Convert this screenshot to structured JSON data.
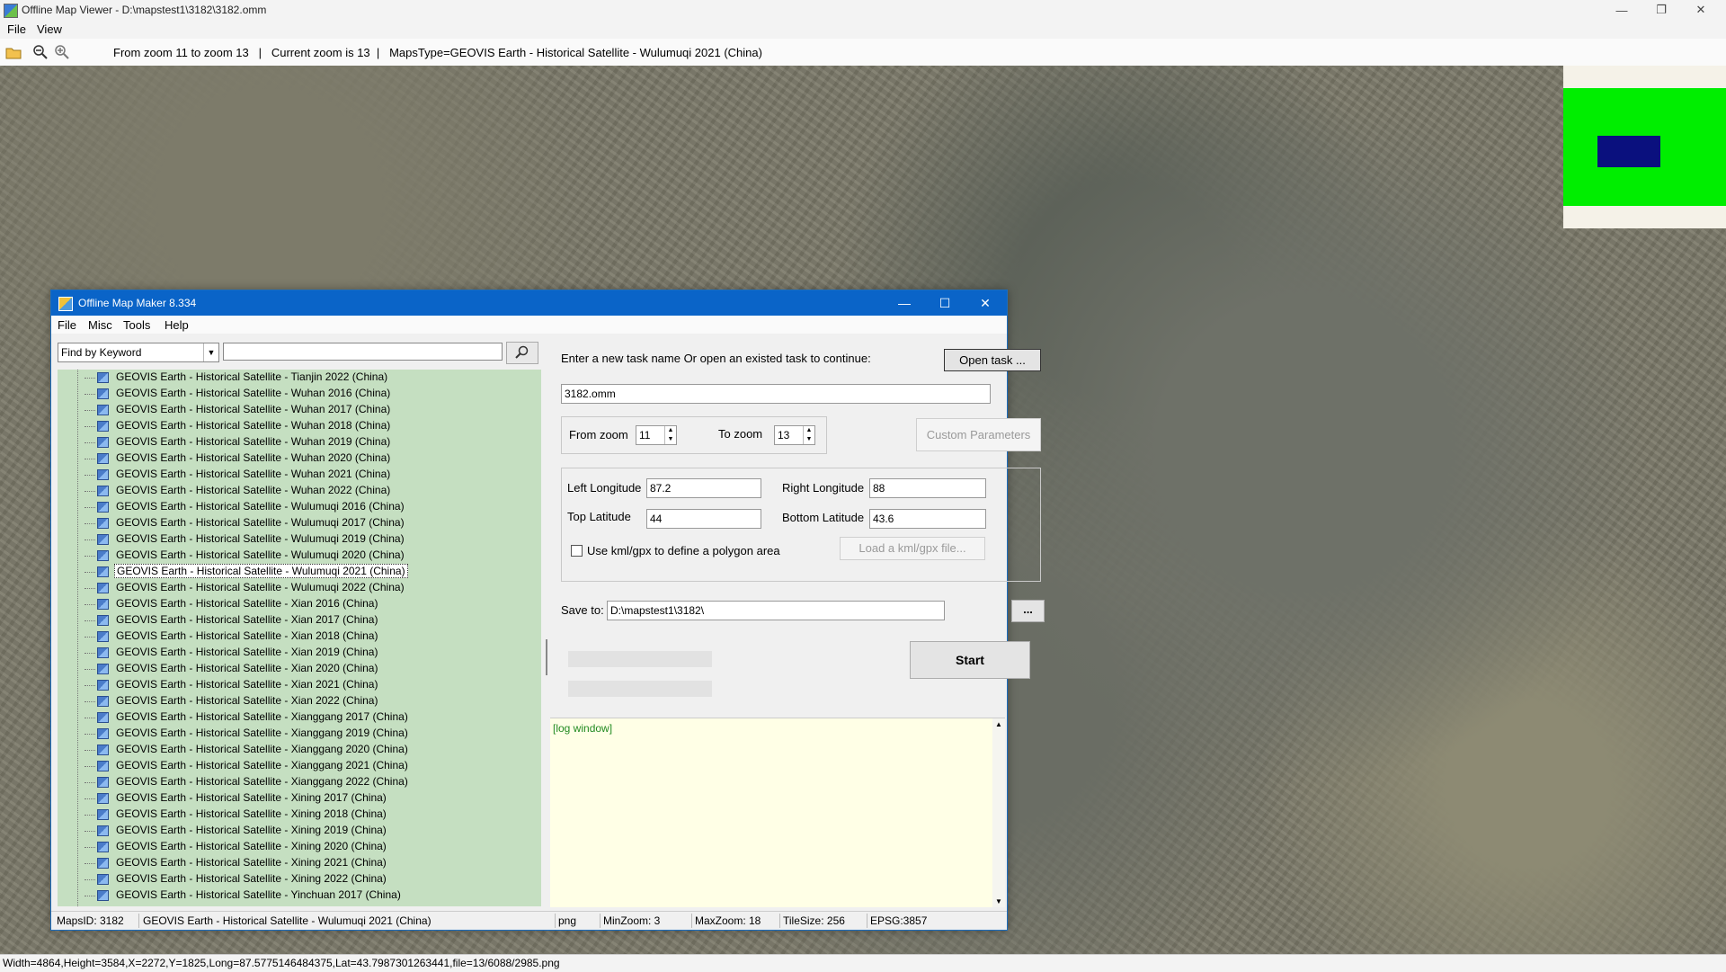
{
  "viewer": {
    "title": "Offline Map Viewer - D:\\mapstest1\\3182\\3182.omm",
    "menu": [
      "File",
      "View"
    ],
    "toolbar_status": {
      "zoom_range": "From zoom 11 to zoom 13",
      "current_zoom": "Current zoom is 13",
      "maps_type": "MapsType=GEOVIS Earth - Historical Satellite - Wulumuqi 2021 (China)"
    },
    "status_line": "Width=4864,Height=3584,X=2272,Y=1825,Long=87.5775146484375,Lat=43.7987301263441,file=13/6088/2985.png",
    "icons": [
      "open-folder-icon",
      "zoom-out-icon",
      "zoom-in-icon",
      "minimize-icon",
      "restore-icon",
      "close-icon"
    ]
  },
  "dialog": {
    "title": "Offline Map Maker 8.334",
    "menu": [
      "File",
      "Misc",
      "Tools",
      "Help"
    ],
    "find_mode": "Find by Keyword",
    "keyword_value": "",
    "tree_items": [
      "GEOVIS Earth - Historical Satellite - Tianjin 2022 (China)",
      "GEOVIS Earth - Historical Satellite - Wuhan 2016 (China)",
      "GEOVIS Earth - Historical Satellite - Wuhan 2017 (China)",
      "GEOVIS Earth - Historical Satellite - Wuhan 2018 (China)",
      "GEOVIS Earth - Historical Satellite - Wuhan 2019 (China)",
      "GEOVIS Earth - Historical Satellite - Wuhan 2020 (China)",
      "GEOVIS Earth - Historical Satellite - Wuhan 2021 (China)",
      "GEOVIS Earth - Historical Satellite - Wuhan 2022 (China)",
      "GEOVIS Earth - Historical Satellite - Wulumuqi 2016 (China)",
      "GEOVIS Earth - Historical Satellite - Wulumuqi 2017 (China)",
      "GEOVIS Earth - Historical Satellite - Wulumuqi 2019 (China)",
      "GEOVIS Earth - Historical Satellite - Wulumuqi 2020 (China)",
      "GEOVIS Earth - Historical Satellite - Wulumuqi 2021 (China)",
      "GEOVIS Earth - Historical Satellite - Wulumuqi 2022 (China)",
      "GEOVIS Earth - Historical Satellite - Xian 2016 (China)",
      "GEOVIS Earth - Historical Satellite - Xian 2017 (China)",
      "GEOVIS Earth - Historical Satellite - Xian 2018 (China)",
      "GEOVIS Earth - Historical Satellite - Xian 2019 (China)",
      "GEOVIS Earth - Historical Satellite - Xian 2020 (China)",
      "GEOVIS Earth - Historical Satellite - Xian 2021 (China)",
      "GEOVIS Earth - Historical Satellite - Xian 2022 (China)",
      "GEOVIS Earth - Historical Satellite - Xianggang 2017 (China)",
      "GEOVIS Earth - Historical Satellite - Xianggang 2019 (China)",
      "GEOVIS Earth - Historical Satellite - Xianggang 2020 (China)",
      "GEOVIS Earth - Historical Satellite - Xianggang 2021 (China)",
      "GEOVIS Earth - Historical Satellite - Xianggang 2022 (China)",
      "GEOVIS Earth - Historical Satellite - Xining 2017 (China)",
      "GEOVIS Earth - Historical Satellite - Xining 2018 (China)",
      "GEOVIS Earth - Historical Satellite - Xining 2019 (China)",
      "GEOVIS Earth - Historical Satellite - Xining 2020 (China)",
      "GEOVIS Earth - Historical Satellite - Xining 2021 (China)",
      "GEOVIS Earth - Historical Satellite - Xining 2022 (China)",
      "GEOVIS Earth - Historical Satellite - Yinchuan 2017 (China)"
    ],
    "selected_item": "GEOVIS Earth - Historical Satellite - Wulumuqi 2021 (China)",
    "task_prompt": "Enter a new task name Or open an existed task to continue:",
    "open_task_label": "Open task ...",
    "task_name": "3182.omm",
    "from_zoom_label": "From zoom",
    "from_zoom": "11",
    "to_zoom_label": "To zoom",
    "to_zoom": "13",
    "custom_params_label": "Custom Parameters",
    "left_lon_label": "Left Longitude",
    "left_lon": "87.2",
    "right_lon_label": "Right Longitude",
    "right_lon": "88",
    "top_lat_label": "Top Latitude",
    "top_lat": "44",
    "bottom_lat_label": "Bottom Latitude",
    "bottom_lat": "43.6",
    "kml_label": "Use kml/gpx to define a polygon area",
    "load_kml_label": "Load a kml/gpx file...",
    "save_to_label": "Save to:",
    "save_to": "D:\\mapstest1\\3182\\",
    "browse_label": "...",
    "start_label": "Start",
    "log_text": "[log window]",
    "status": {
      "maps_id": "MapsID: 3182",
      "maps_name": "GEOVIS Earth - Historical Satellite - Wulumuqi 2021 (China)",
      "format": "png",
      "min_zoom": "MinZoom: 3",
      "max_zoom": "MaxZoom: 18",
      "tile_size": "TileSize: 256",
      "epsg": "EPSG:3857"
    }
  },
  "colors": {
    "dialog_titlebar": "#0a64c8",
    "tree_background": "#c5dfc1",
    "log_background": "#ffffe6",
    "minimap_green": "#00ee00",
    "minimap_viewport": "#0a107e"
  }
}
